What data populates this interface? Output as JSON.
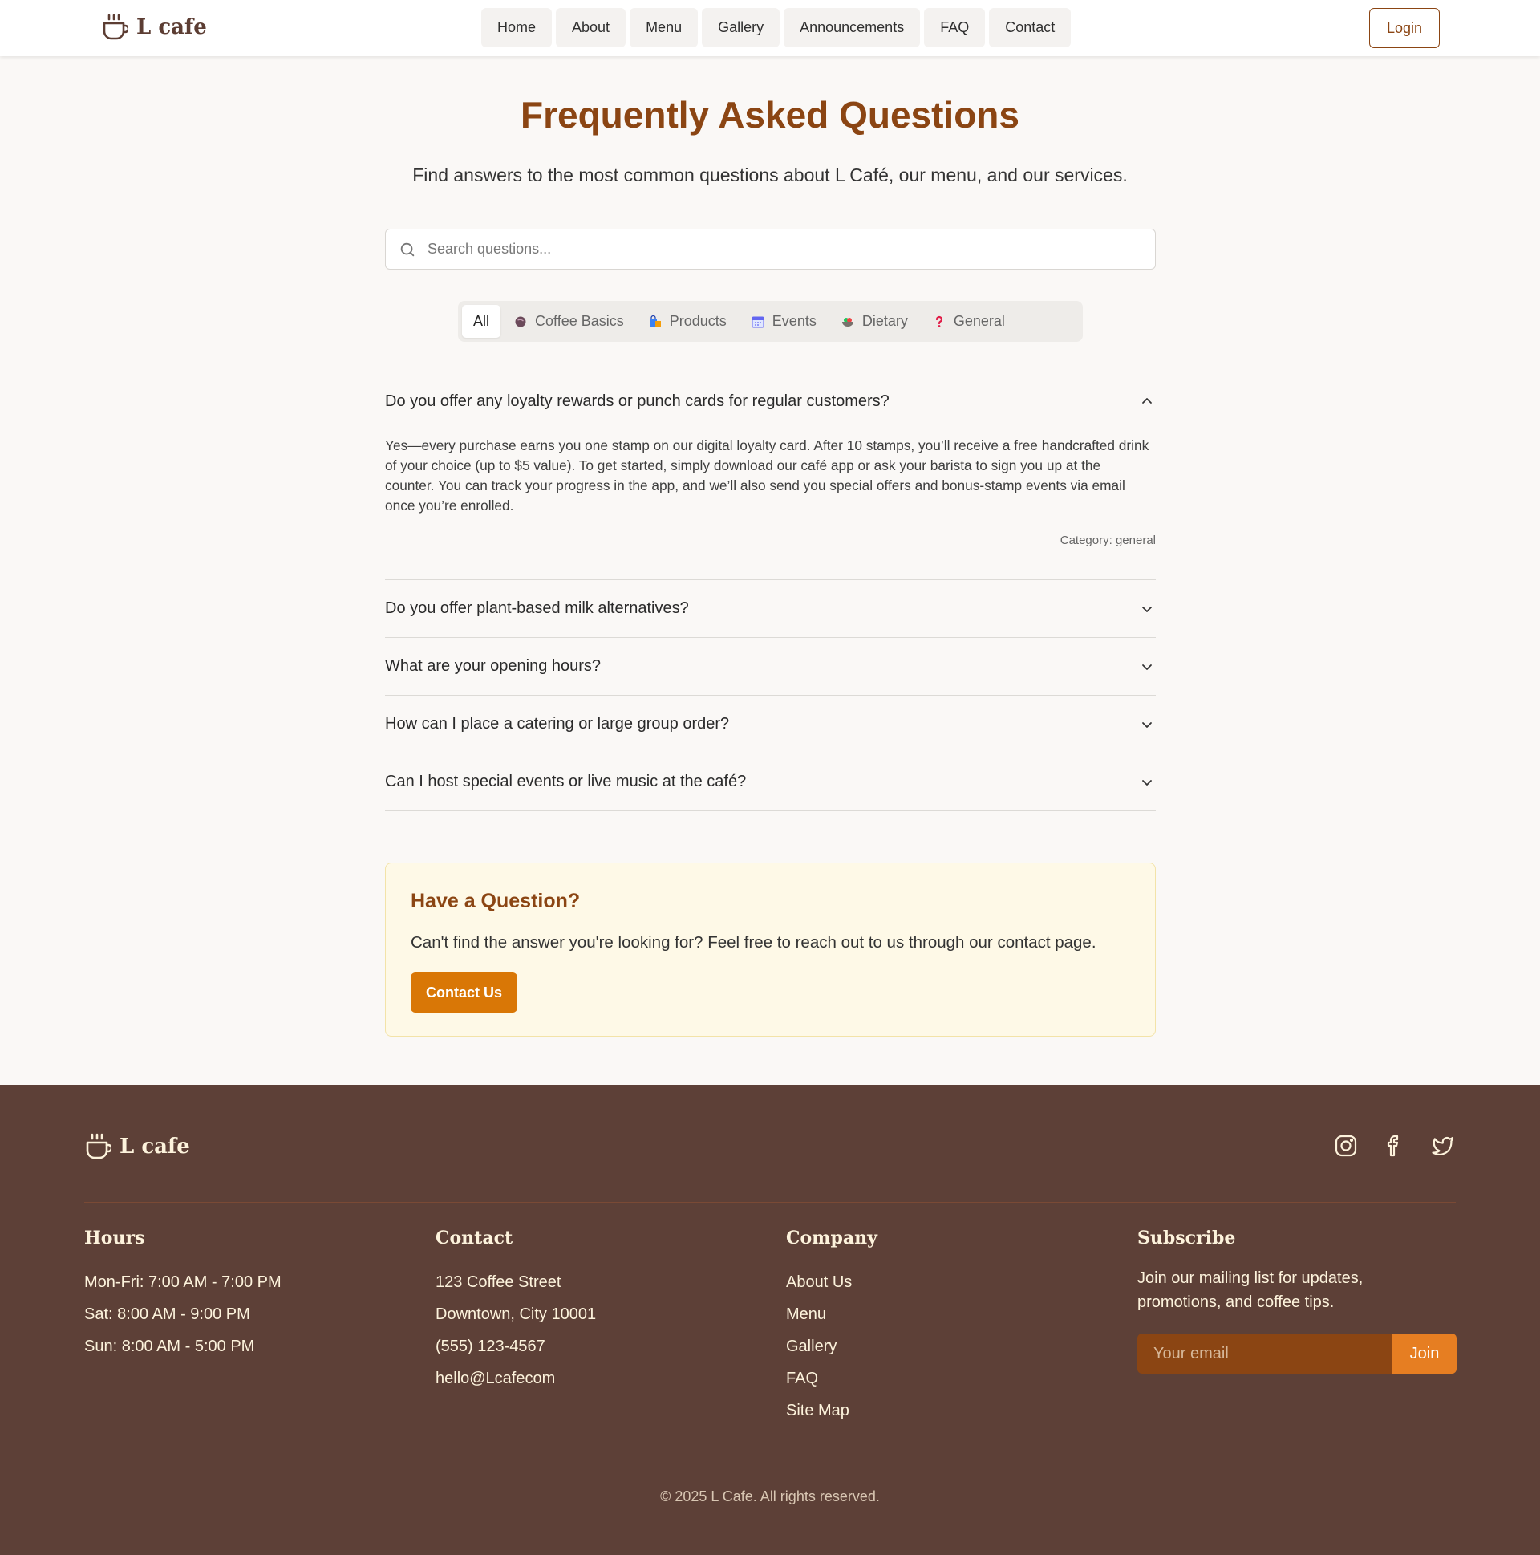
{
  "header": {
    "brand": "L cafe",
    "nav": [
      "Home",
      "About",
      "Menu",
      "Gallery",
      "Announcements",
      "FAQ",
      "Contact"
    ],
    "login": "Login"
  },
  "main": {
    "title": "Frequently Asked Questions",
    "subtitle": "Find answers to the most common questions about L Café, our menu, and our services.",
    "search_placeholder": "Search questions...",
    "tabs": [
      {
        "label": "All",
        "icon": null,
        "active": true
      },
      {
        "label": "Coffee Basics",
        "icon": "coffee-bean-icon"
      },
      {
        "label": "Products",
        "icon": "shopping-bag-icon"
      },
      {
        "label": "Events",
        "icon": "calendar-icon"
      },
      {
        "label": "Dietary",
        "icon": "salad-icon"
      },
      {
        "label": "General",
        "icon": "question-mark-icon"
      }
    ],
    "faqs": [
      {
        "question": "Do you offer any loyalty rewards or punch cards for regular customers?",
        "answer": "Yes—every purchase earns you one stamp on our digital loyalty card. After 10 stamps, you’ll receive a free handcrafted drink of your choice (up to $5 value). To get started, simply download our café app or ask your barista to sign you up at the counter. You can track your progress in the app, and we’ll also send you special offers and bonus-stamp events via email once you’re enrolled.",
        "category": "Category: general",
        "open": true
      },
      {
        "question": "Do you offer plant-based milk alternatives?"
      },
      {
        "question": "What are your opening hours?"
      },
      {
        "question": "How can I place a catering or large group order?"
      },
      {
        "question": "Can I host special events or live music at the café?"
      }
    ],
    "question_box": {
      "title": "Have a Question?",
      "text": "Can't find the answer you're looking for? Feel free to reach out to us through our contact page.",
      "button": "Contact Us"
    }
  },
  "footer": {
    "brand": "L cafe",
    "hours": {
      "title": "Hours",
      "lines": [
        "Mon-Fri: 7:00 AM - 7:00 PM",
        "Sat: 8:00 AM - 9:00 PM",
        "Sun: 8:00 AM - 5:00 PM"
      ]
    },
    "contact": {
      "title": "Contact",
      "lines": [
        "123 Coffee Street",
        "Downtown, City 10001",
        "(555) 123-4567",
        "hello@Lcafecom"
      ]
    },
    "company": {
      "title": "Company",
      "links": [
        "About Us",
        "Menu",
        "Gallery",
        "FAQ",
        "Site Map"
      ]
    },
    "subscribe": {
      "title": "Subscribe",
      "text": "Join our mailing list for updates, promotions, and coffee tips.",
      "placeholder": "Your email",
      "button": "Join"
    },
    "copyright": "© 2025 L Cafe. All rights reserved."
  },
  "colors": {
    "accent": "#8b4513",
    "cta": "#d97706",
    "footer_bg": "#5d4037",
    "join": "#e67e22"
  }
}
